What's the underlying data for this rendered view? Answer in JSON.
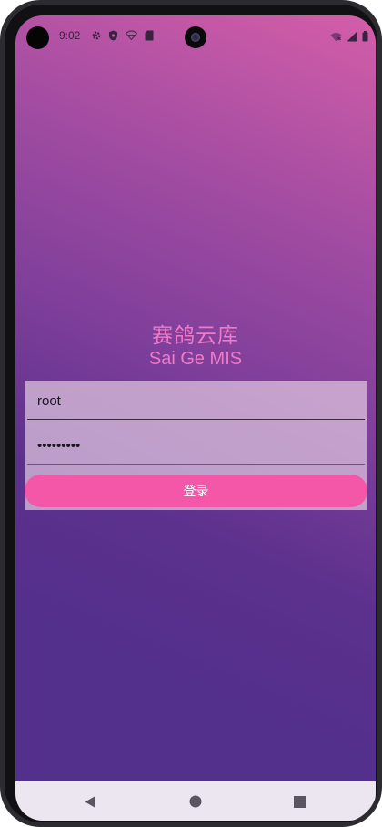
{
  "status_bar": {
    "time": "9:02",
    "left_icons": [
      "settings-icon",
      "shield-icon",
      "wifi-off-icon",
      "sim-card-icon"
    ],
    "right_icons": [
      "wifi-icon",
      "signal-icon",
      "battery-icon"
    ]
  },
  "app": {
    "title": "赛鸽云库",
    "subtitle": "Sai Ge MIS"
  },
  "login": {
    "username_value": "root",
    "password_value": "•••••••••",
    "button_label": "登录"
  },
  "nav_bar": {
    "buttons": [
      "back-icon",
      "home-icon",
      "recents-icon"
    ]
  },
  "colors": {
    "accent": "#f456a8",
    "title": "#f07ac8",
    "background_top": "#d45ea8",
    "background_bottom": "#53308c"
  }
}
